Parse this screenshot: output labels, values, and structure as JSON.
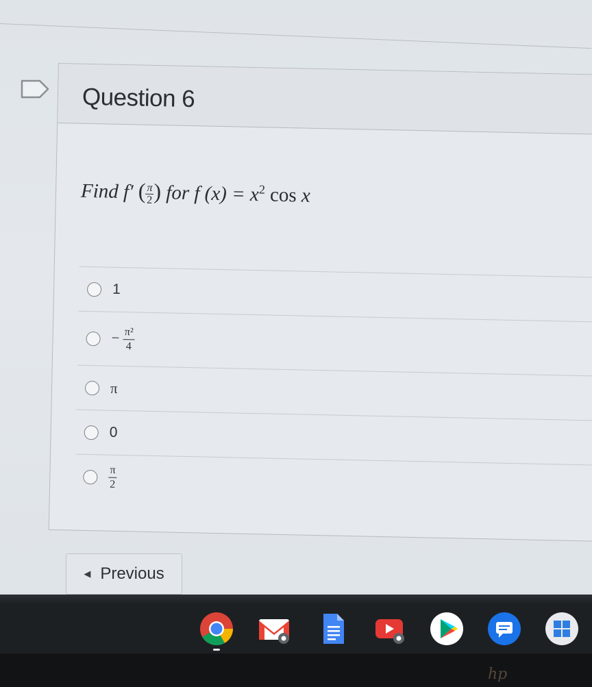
{
  "question": {
    "title": "Question 6",
    "prompt": {
      "find": "Find",
      "f_prime": "f′",
      "arg_num": "π",
      "arg_den": "2",
      "for_word": "for",
      "f_of_x": "f (x) =",
      "x_var": "x",
      "exponent": "2",
      "cos_text": "cos",
      "cos_arg": "x"
    }
  },
  "answers": [
    {
      "text": "1"
    },
    {
      "sign": "−",
      "num": "π²",
      "den": "4"
    },
    {
      "text": "π"
    },
    {
      "text": "0"
    },
    {
      "num": "π",
      "den": "2"
    }
  ],
  "navigation": {
    "previous_label": "Previous"
  },
  "shelf": {
    "apps": [
      "chrome-icon",
      "gmail-icon",
      "docs-icon",
      "youtube-icon",
      "play-store-icon",
      "messages-icon",
      "windows-icon"
    ]
  }
}
